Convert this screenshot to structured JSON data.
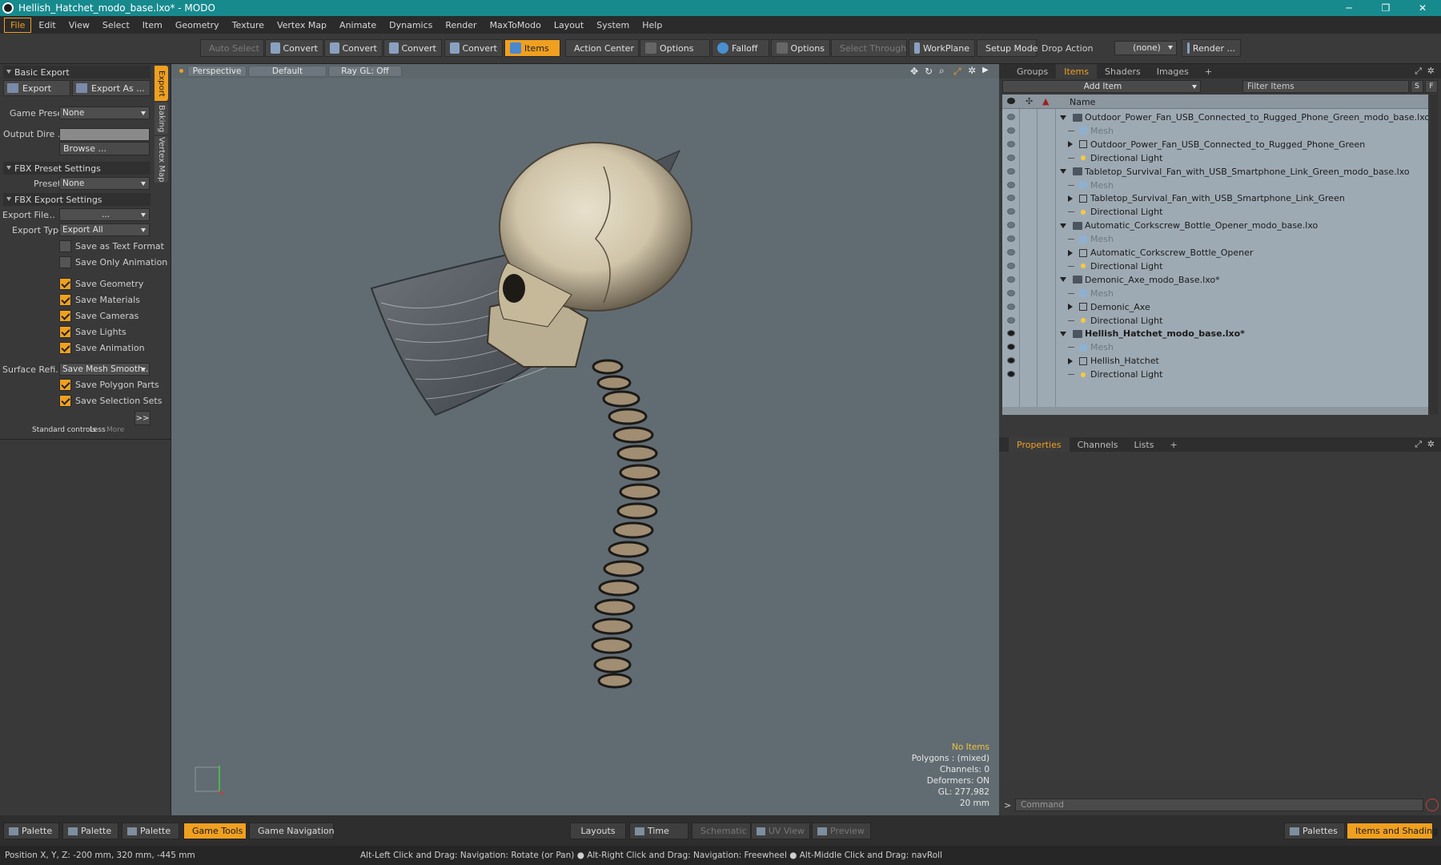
{
  "window": {
    "title": "Hellish_Hatchet_modo_base.lxo* - MODO",
    "minimize": "─",
    "maximize": "❐",
    "close": "✕"
  },
  "menu": [
    "File",
    "Edit",
    "View",
    "Select",
    "Item",
    "Geometry",
    "Texture",
    "Vertex Map",
    "Animate",
    "Dynamics",
    "Render",
    "MaxToModo",
    "Layout",
    "System",
    "Help"
  ],
  "toolbar": {
    "auto_select": "Auto Select",
    "convert1": "Convert",
    "convert2": "Convert",
    "convert3": "Convert",
    "convert4": "Convert",
    "items": "Items",
    "action_center": "Action Center",
    "options1": "Options",
    "falloff": "Falloff",
    "options2": "Options",
    "select_through": "Select Through",
    "workplane": "WorkPlane",
    "setup_mode": "Setup Mode",
    "drop_action_label": "Drop Action",
    "drop_action_value": "(none)",
    "render": "Render ..."
  },
  "left": {
    "side_tabs": [
      "Export",
      "Baking",
      "Vertex Map"
    ],
    "basic_export": "Basic Export",
    "export_btn": "Export",
    "export_as_btn": "Export As ...",
    "game_preset_label": "Game Preset",
    "game_preset_value": "None",
    "output_dir_label": "Output Dire ...",
    "browse_btn": "Browse ...",
    "fbx_preset_settings": "FBX Preset Settings",
    "preset_label": "Preset",
    "preset_value": "None",
    "fbx_export_settings": "FBX Export Settings",
    "export_file_label": "Export File",
    "export_file_value": "...",
    "export_type_label": "Export Type",
    "export_type_value": "Export All",
    "save_text": "Save as Text Format",
    "save_only_anim": "Save Only Animation",
    "save_geometry": "Save Geometry",
    "save_materials": "Save Materials",
    "save_cameras": "Save Cameras",
    "save_lights": "Save Lights",
    "save_animation": "Save Animation",
    "surface_refi_label": "Surface Refi...",
    "surface_refi_value": "Save Mesh Smooth...",
    "save_polygon_parts": "Save Polygon Parts",
    "save_selection_sets": "Save Selection Sets",
    "more_btn": ">>",
    "standard_controls": "Standard controls",
    "less": "Less",
    "more": "More"
  },
  "viewport": {
    "perspective": "Perspective",
    "default": "Default",
    "raygl": "Ray GL: Off",
    "info": {
      "no_items": "No Items",
      "polygons": "Polygons : (mixed)",
      "channels": "Channels: 0",
      "deformers": "Deformers: ON",
      "gl": "GL: 277,982",
      "scale": "20 mm"
    }
  },
  "right": {
    "tabs": [
      "Groups",
      "Items",
      "Shaders",
      "Images",
      "+"
    ],
    "add_item": "Add Item",
    "filter": "Filter Items",
    "s_btn": "S",
    "f_btn": "F",
    "col_name": "Name",
    "rows": [
      {
        "kind": "scene",
        "text": "Outdoor_Power_Fan_USB_Connected_to_Rugged_Phone_Green_modo_base.lxo"
      },
      {
        "kind": "mesh",
        "text": "Mesh"
      },
      {
        "kind": "group",
        "text": "Outdoor_Power_Fan_USB_Connected_to_Rugged_Phone_Green"
      },
      {
        "kind": "light",
        "text": "Directional Light"
      },
      {
        "kind": "scene",
        "text": "Tabletop_Survival_Fan_with_USB_Smartphone_Link_Green_modo_base.lxo"
      },
      {
        "kind": "mesh",
        "text": "Mesh"
      },
      {
        "kind": "group",
        "text": "Tabletop_Survival_Fan_with_USB_Smartphone_Link_Green"
      },
      {
        "kind": "light",
        "text": "Directional Light"
      },
      {
        "kind": "scene",
        "text": "Automatic_Corkscrew_Bottle_Opener_modo_base.lxo"
      },
      {
        "kind": "mesh",
        "text": "Mesh"
      },
      {
        "kind": "group",
        "text": "Automatic_Corkscrew_Bottle_Opener"
      },
      {
        "kind": "light",
        "text": "Directional Light"
      },
      {
        "kind": "scene",
        "text": "Demonic_Axe_modo_Base.lxo*"
      },
      {
        "kind": "mesh",
        "text": "Mesh"
      },
      {
        "kind": "group",
        "text": "Demonic_Axe"
      },
      {
        "kind": "light",
        "text": "Directional Light"
      },
      {
        "kind": "scene-active",
        "text": "Hellish_Hatchet_modo_base.lxo*"
      },
      {
        "kind": "mesh",
        "text": "Mesh"
      },
      {
        "kind": "group",
        "text": "Hellish_Hatchet"
      },
      {
        "kind": "light",
        "text": "Directional Light"
      }
    ],
    "prop_tabs": [
      "Properties",
      "Channels",
      "Lists",
      "+"
    ],
    "command_prompt": ">",
    "command_placeholder": "Command"
  },
  "bottom": {
    "palette1": "Palette",
    "palette2": "Palette",
    "palette3": "Palette",
    "game_tools": "Game Tools",
    "game_navigation": "Game Navigation",
    "layouts": "Layouts",
    "time": "Time",
    "schematic": "Schematic",
    "uv_view": "UV View",
    "preview": "Preview",
    "palettes": "Palettes",
    "items_shading": "Items and Shading"
  },
  "status": {
    "position": "Position X, Y, Z:  -200 mm, 320 mm, -445 mm",
    "hint": "Alt-Left Click and Drag: Navigation: Rotate (or Pan) ● Alt-Right Click and Drag: Navigation: Freewheel ● Alt-Middle Click and Drag: navRoll"
  },
  "colors": {
    "accent": "#f0a020",
    "titlebar": "#178a8e",
    "viewport_bg": "#616c72",
    "itemlist_bg": "#9eaab3"
  }
}
